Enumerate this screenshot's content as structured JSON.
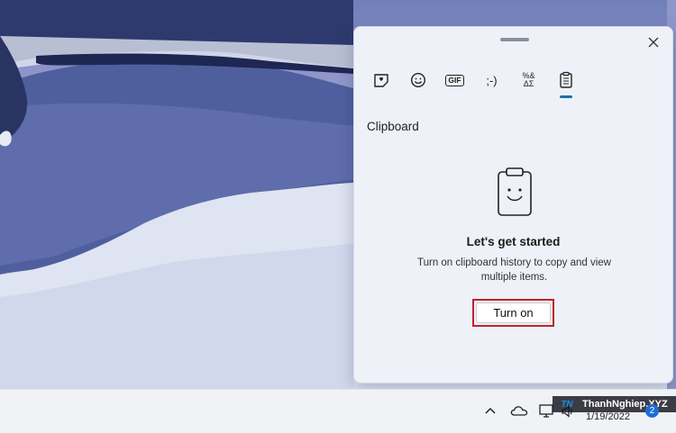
{
  "panel": {
    "tabs": [
      {
        "name": "Kaomoji favorites",
        "icon": "heart-sticker-icon"
      },
      {
        "name": "Emoji",
        "icon": "smiley-icon"
      },
      {
        "name": "GIF",
        "icon": "gif-icon",
        "label": "GIF"
      },
      {
        "name": "Kaomoji",
        "icon": "kaomoji-icon",
        "label": ";-)"
      },
      {
        "name": "Symbols",
        "icon": "symbols-icon",
        "label": "%&"
      },
      {
        "name": "Clipboard",
        "icon": "clipboard-icon",
        "active": true
      }
    ],
    "section_title": "Clipboard",
    "heading": "Let's get started",
    "description": "Turn on clipboard history to copy and view multiple items.",
    "turn_on_label": "Turn on"
  },
  "taskbar": {
    "date": "1/19/2022",
    "notification_count": "2",
    "watermark": "ThanhNghiep.XYZ",
    "watermark_logo": "TN"
  },
  "colors": {
    "accent": "#1a6fb0",
    "highlight_border": "#c4212b"
  }
}
